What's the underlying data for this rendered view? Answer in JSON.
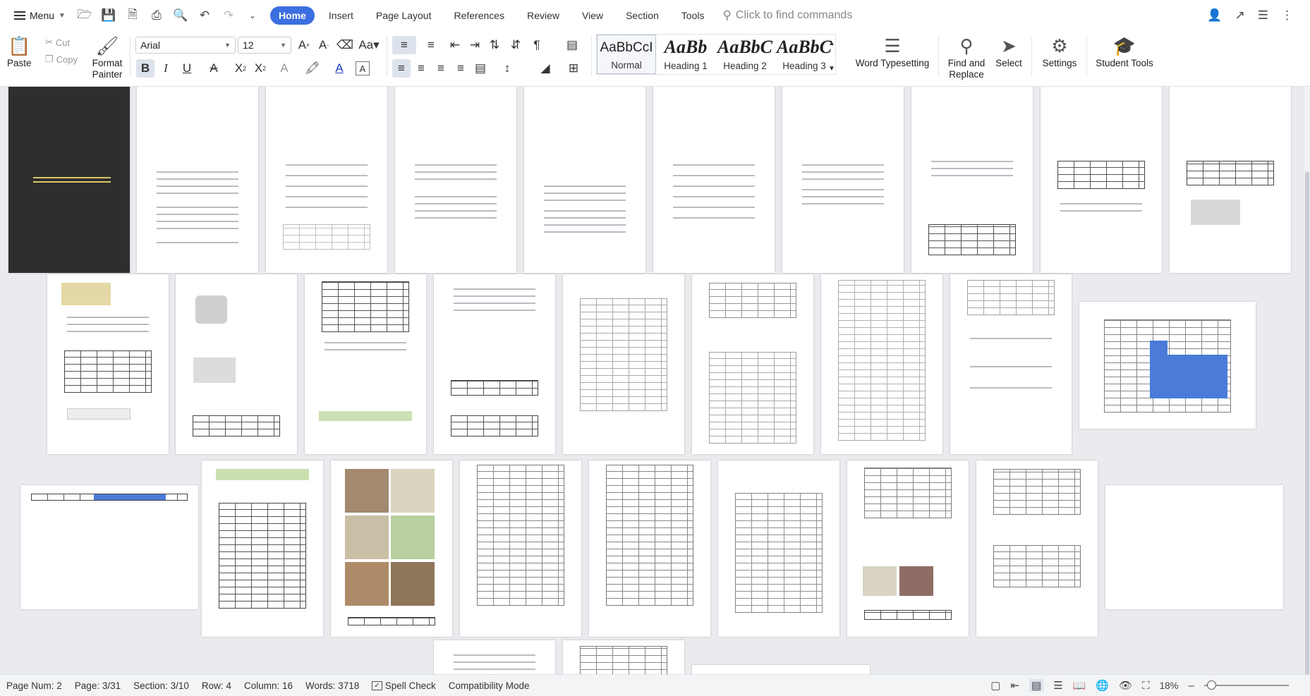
{
  "menubar": {
    "menu_label": "Menu",
    "tabs": [
      {
        "label": "Home",
        "active": true
      },
      {
        "label": "Insert"
      },
      {
        "label": "Page Layout"
      },
      {
        "label": "References"
      },
      {
        "label": "Review"
      },
      {
        "label": "View"
      },
      {
        "label": "Section"
      },
      {
        "label": "Tools"
      }
    ],
    "search_placeholder": "Click to find commands"
  },
  "ribbon": {
    "paste_label": "Paste",
    "cut_label": "Cut",
    "copy_label": "Copy",
    "format_painter_label": "Format Painter",
    "font_name": "Arial",
    "font_size": "12",
    "styles": [
      {
        "preview": "AaBbCcI",
        "name": "Normal"
      },
      {
        "preview": "AaBb",
        "name": "Heading 1"
      },
      {
        "preview": "AaBbC",
        "name": "Heading 2"
      },
      {
        "preview": "AaBbC",
        "name": "Heading 3"
      }
    ],
    "word_typesetting_label": "Word Typesetting",
    "find_replace_label": "Find and Replace",
    "select_label": "Select",
    "settings_label": "Settings",
    "student_tools_label": "Student Tools"
  },
  "statusbar": {
    "page_num": "Page Num: 2",
    "page": "Page: 3/31",
    "section": "Section: 3/10",
    "row": "Row: 4",
    "column": "Column: 16",
    "words": "Words: 3718",
    "spell_check": "Spell Check",
    "compat_mode": "Compatibility Mode",
    "zoom": "18%"
  },
  "colors": {
    "accent": "#3b6fe0",
    "table_fill": "#4a7bd8"
  }
}
